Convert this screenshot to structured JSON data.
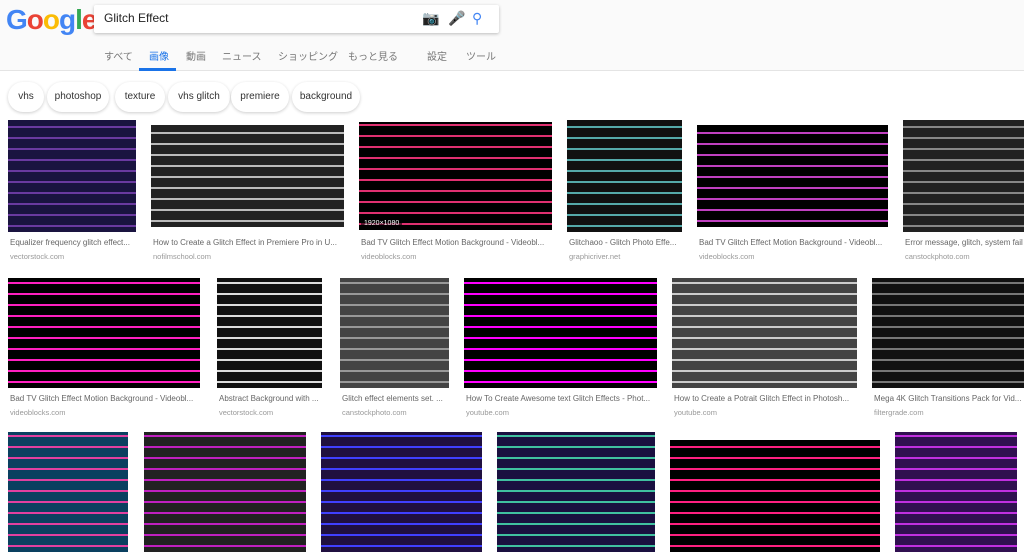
{
  "logo": "Google",
  "search": {
    "query": "Glitch Effect"
  },
  "tabs": [
    {
      "label": "すべて"
    },
    {
      "label": "画像",
      "active": true
    },
    {
      "label": "動画"
    },
    {
      "label": "ニュース"
    },
    {
      "label": "ショッピング"
    },
    {
      "label": "もっと見る"
    },
    {
      "label": "設定"
    },
    {
      "label": "ツール"
    }
  ],
  "chips": [
    "vhs",
    "photoshop",
    "texture",
    "vhs glitch",
    "premiere",
    "background"
  ],
  "results": [
    {
      "caption": "Equalizer frequency glitch effect...",
      "source": "vectorstock.com",
      "colors": [
        "#1a1440",
        "#6a3aa0"
      ]
    },
    {
      "caption": "How to Create a Glitch Effect in Premiere Pro in U...",
      "source": "nofilmschool.com",
      "colors": [
        "#222",
        "#bbb"
      ]
    },
    {
      "caption": "Bad TV Glitch Effect Motion Background - Videobl...",
      "source": "videoblocks.com",
      "colors": [
        "#000",
        "#e03070"
      ],
      "badge": "1920×1080"
    },
    {
      "caption": "Glitchaoo - Glitch Photo Effe...",
      "source": "graphicriver.net",
      "colors": [
        "#111",
        "#5aa"
      ]
    },
    {
      "caption": "Bad TV Glitch Effect Motion Background - Videobl...",
      "source": "videoblocks.com",
      "colors": [
        "#000",
        "#c040c0"
      ]
    },
    {
      "caption": "Error message, glitch, system fail",
      "source": "canstockphoto.com",
      "colors": [
        "#222",
        "#888"
      ]
    },
    {
      "caption": "Bad TV Glitch Effect Motion Background - Videobl...",
      "source": "videoblocks.com",
      "colors": [
        "#000",
        "#ff20c0"
      ]
    },
    {
      "caption": "Abstract Background with ...",
      "source": "vectorstock.com",
      "colors": [
        "#111",
        "#ddd"
      ]
    },
    {
      "caption": "Glitch effect elements set. ...",
      "source": "canstockphoto.com",
      "colors": [
        "#444",
        "#999"
      ]
    },
    {
      "caption": "How To Create Awesome text Glitch Effects - Phot...",
      "source": "youtube.com",
      "colors": [
        "#000",
        "#f0f"
      ]
    },
    {
      "caption": "How to Create a Potrait Glitch Effect in Photosh...",
      "source": "youtube.com",
      "colors": [
        "#444",
        "#ccc"
      ]
    },
    {
      "caption": "Mega 4K Glitch Transitions Pack for Vid...",
      "source": "filtergrade.com",
      "colors": [
        "#111",
        "#777"
      ]
    },
    {
      "colors": [
        "#0a4060",
        "#e040a0"
      ]
    },
    {
      "colors": [
        "#222",
        "#c020c0"
      ]
    },
    {
      "colors": [
        "#201040",
        "#4040ff"
      ]
    },
    {
      "colors": [
        "#1a1040",
        "#40c0a0"
      ]
    },
    {
      "colors": [
        "#000",
        "#ff2080"
      ]
    },
    {
      "colors": [
        "#301050",
        "#c030e0"
      ]
    }
  ]
}
